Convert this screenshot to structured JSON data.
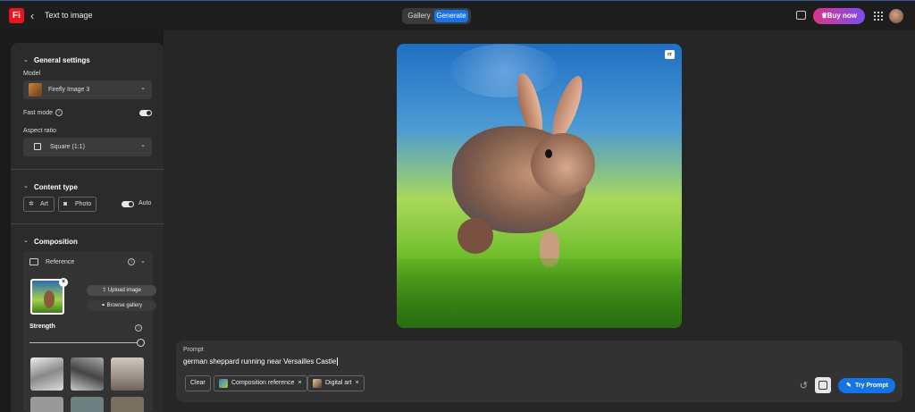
{
  "app": {
    "logo": "Fi",
    "back_icon": "chevron-left-icon",
    "title": "Text to image"
  },
  "header": {
    "tabs": [
      {
        "label": "Gallery",
        "active": false
      },
      {
        "label": "Generate",
        "active": true
      }
    ],
    "buy_label": "Buy now",
    "accent": "#1473e6"
  },
  "sidebar": {
    "general": {
      "title": "General settings",
      "model_label": "Model",
      "model_value": "Firefly Image 3",
      "fast_mode_label": "Fast mode",
      "fast_mode_on": true,
      "aspect_label": "Aspect ratio",
      "aspect_value": "Square (1:1)"
    },
    "content_type": {
      "title": "Content type",
      "art_label": "Art",
      "photo_label": "Photo",
      "auto_label": "Auto",
      "auto_on": true
    },
    "composition": {
      "title": "Composition",
      "reference_label": "Reference",
      "upload_label": "Upload image",
      "browse_label": "Browse gallery",
      "strength_label": "Strength",
      "strength_value": 1.0
    }
  },
  "prompt": {
    "label": "Prompt",
    "text": "german sheppard running near Versailles Castle",
    "clear_label": "Clear",
    "chips": [
      {
        "label": "Composition reference"
      },
      {
        "label": "Digital art"
      }
    ],
    "try_label": "Try Prompt"
  },
  "image": {
    "badge": "cr"
  }
}
